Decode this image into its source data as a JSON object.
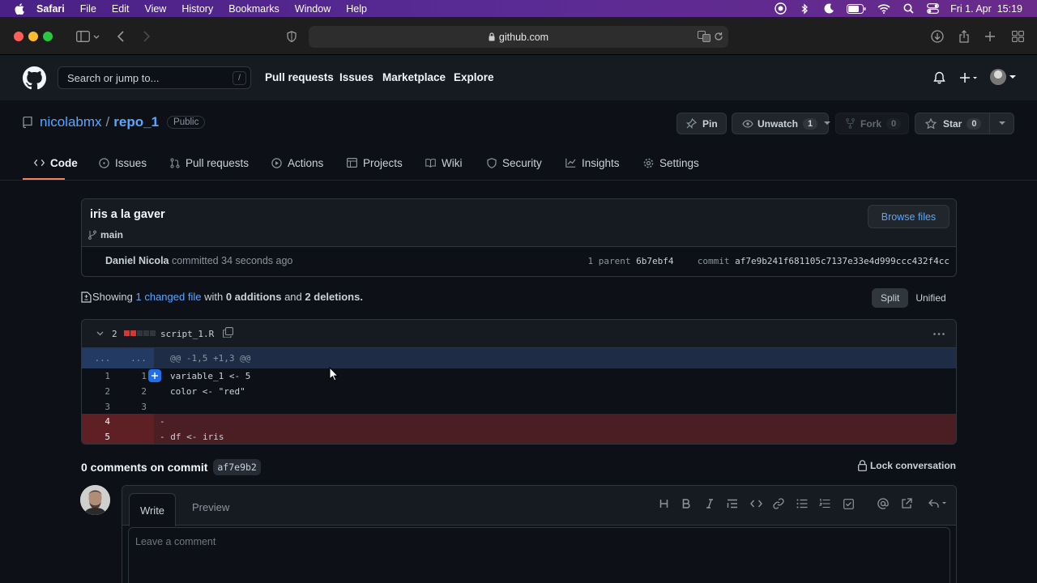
{
  "menubar": {
    "app": "Safari",
    "items": [
      "File",
      "Edit",
      "View",
      "History",
      "Bookmarks",
      "Window",
      "Help"
    ],
    "datetime": "Fri 1. Apr  15:19"
  },
  "browser": {
    "url": "github.com"
  },
  "github": {
    "search_placeholder": "Search or jump to...",
    "search_shortcut": "/",
    "nav": [
      "Pull requests",
      "Issues",
      "Marketplace",
      "Explore"
    ]
  },
  "repo": {
    "owner": "nicolabmx",
    "separator": "/",
    "name": "repo_1",
    "visibility": "Public",
    "pin_label": "Pin",
    "unwatch_label": "Unwatch",
    "watch_count": "1",
    "fork_label": "Fork",
    "fork_count": "0",
    "star_label": "Star",
    "star_count": "0",
    "tabs": [
      "Code",
      "Issues",
      "Pull requests",
      "Actions",
      "Projects",
      "Wiki",
      "Security",
      "Insights",
      "Settings"
    ]
  },
  "commit": {
    "title": "iris a la gaver",
    "branch": "main",
    "browse_label": "Browse files",
    "author": "Daniel Nicola",
    "action": "committed",
    "time": "34 seconds ago",
    "parent_label": "1 parent",
    "parent_sha": "6b7ebf4",
    "commit_label": "commit",
    "sha": "af7e9b241f681105c7137e33e4d999ccc432f4cc"
  },
  "summary": {
    "showing": "Showing",
    "changed": "1 changed file",
    "with": "with",
    "additions": "0 additions",
    "and": "and",
    "deletions": "2 deletions.",
    "split": "Split",
    "unified": "Unified"
  },
  "diff": {
    "count": "2",
    "filename": "script_1.R",
    "hunk_dots_left": "...",
    "hunk_dots_right": "...",
    "hunk": "@@ -1,5 +1,3 @@",
    "lines": [
      {
        "old": "1",
        "new": "1",
        "code": "variable_1 <- 5",
        "type": "ctx"
      },
      {
        "old": "2",
        "new": "2",
        "code": "color <- \"red\"",
        "type": "ctx"
      },
      {
        "old": "3",
        "new": "3",
        "code": "",
        "type": "ctx"
      },
      {
        "old": "4",
        "new": "",
        "code": "-",
        "type": "del"
      },
      {
        "old": "5",
        "new": "",
        "code": "- df <- iris",
        "type": "del"
      }
    ]
  },
  "comments": {
    "heading": "0 comments on commit",
    "short_sha": "af7e9b2",
    "lock_label": "Lock conversation",
    "write_tab": "Write",
    "preview_tab": "Preview",
    "placeholder": "Leave a comment"
  }
}
